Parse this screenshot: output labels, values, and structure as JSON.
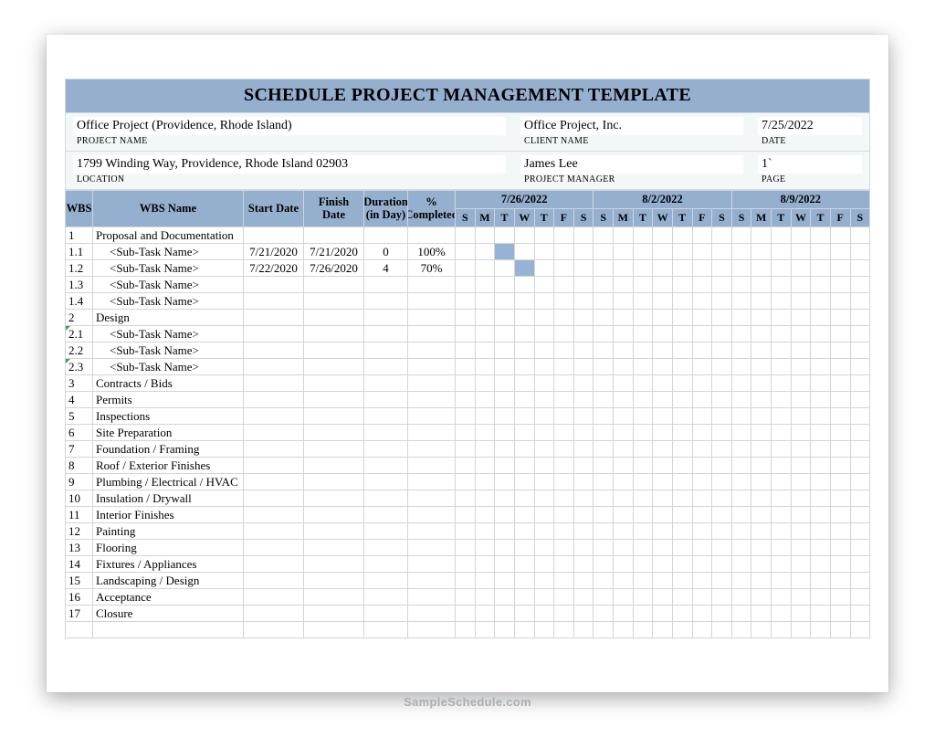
{
  "title": "SCHEDULE PROJECT MANAGEMENT  TEMPLATE",
  "watermark": "SampleSchedule.com",
  "info": {
    "project_name_value": "Office Project (Providence, Rhode Island)",
    "project_name_label": "PROJECT NAME",
    "location_value": "1799  Winding Way, Providence, Rhode Island   02903",
    "location_label": "LOCATION",
    "client_name_value": "Office Project, Inc.",
    "client_name_label": "CLIENT NAME",
    "project_manager_value": "James Lee",
    "project_manager_label": "PROJECT MANAGER",
    "date_value": "7/25/2022",
    "date_label": "DATE",
    "page_value": "1`",
    "page_label": "PAGE"
  },
  "columns": {
    "wbs": "WBS",
    "name": "WBS Name",
    "start": "Start Date",
    "finish": "Finish Date",
    "duration": "Duration (in Day)",
    "completed": "% Completed"
  },
  "week_headers": [
    "7/26/2022",
    "8/2/2022",
    "8/9/2022"
  ],
  "day_letters": [
    "S",
    "M",
    "T",
    "W",
    "T",
    "F",
    "S"
  ],
  "rows": [
    {
      "wbs": "1",
      "name": "Proposal and Documentation",
      "indent": false
    },
    {
      "wbs": "1.1",
      "name": "<Sub-Task Name>",
      "indent": true,
      "start": "7/21/2020",
      "finish": "7/21/2020",
      "duration": "0",
      "completed": "100%",
      "gantt": [
        2
      ]
    },
    {
      "wbs": "1.2",
      "name": "<Sub-Task Name>",
      "indent": true,
      "start": "7/22/2020",
      "finish": "7/26/2020",
      "duration": "4",
      "completed": "70%",
      "gantt": [
        3
      ]
    },
    {
      "wbs": "1.3",
      "name": "<Sub-Task Name>",
      "indent": true
    },
    {
      "wbs": "1.4",
      "name": "<Sub-Task Name>",
      "indent": true
    },
    {
      "wbs": "2",
      "name": "Design",
      "indent": false
    },
    {
      "wbs": "2.1",
      "name": "<Sub-Task Name>",
      "indent": true,
      "tri": true
    },
    {
      "wbs": "2.2",
      "name": "<Sub-Task Name>",
      "indent": true
    },
    {
      "wbs": "2.3",
      "name": "<Sub-Task Name>",
      "indent": true,
      "tri": true
    },
    {
      "wbs": "3",
      "name": "Contracts / Bids",
      "indent": false
    },
    {
      "wbs": "4",
      "name": "Permits",
      "indent": false
    },
    {
      "wbs": "5",
      "name": "Inspections",
      "indent": false
    },
    {
      "wbs": "6",
      "name": "Site Preparation",
      "indent": false
    },
    {
      "wbs": "7",
      "name": "Foundation / Framing",
      "indent": false
    },
    {
      "wbs": "8",
      "name": "Roof / Exterior Finishes",
      "indent": false
    },
    {
      "wbs": "9",
      "name": "Plumbing / Electrical / HVAC",
      "indent": false
    },
    {
      "wbs": "10",
      "name": "Insulation / Drywall",
      "indent": false
    },
    {
      "wbs": "11",
      "name": "Interior Finishes",
      "indent": false
    },
    {
      "wbs": "12",
      "name": "Painting",
      "indent": false
    },
    {
      "wbs": "13",
      "name": "Flooring",
      "indent": false
    },
    {
      "wbs": "14",
      "name": "Fixtures / Appliances",
      "indent": false
    },
    {
      "wbs": "15",
      "name": "Landscaping / Design",
      "indent": false
    },
    {
      "wbs": "16",
      "name": "Acceptance",
      "indent": false
    },
    {
      "wbs": "17",
      "name": "Closure",
      "indent": false
    },
    {
      "wbs": "",
      "name": "",
      "indent": false
    }
  ]
}
